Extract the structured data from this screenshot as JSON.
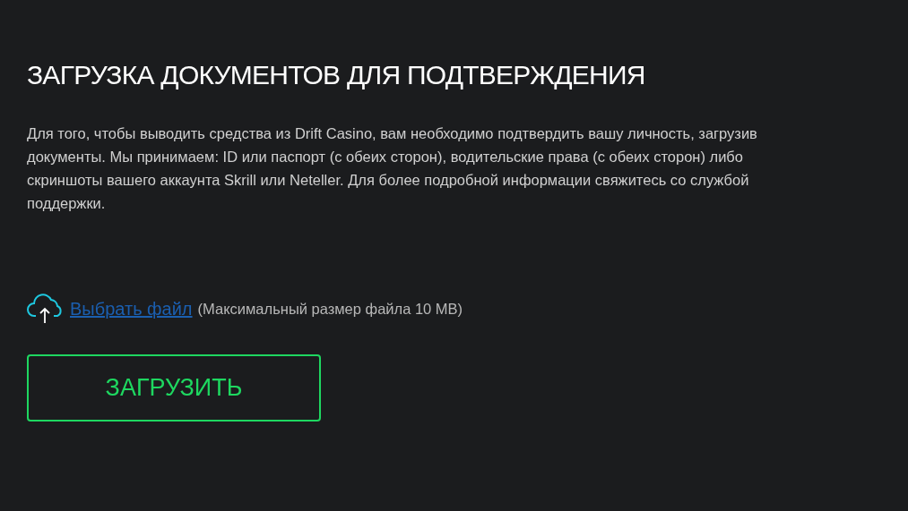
{
  "title": "ЗАГРУЗКА ДОКУМЕНТОВ ДЛЯ ПОДТВЕРЖДЕНИЯ",
  "description": "Для того, чтобы выводить средства из Drift Casino, вам необходимо подтвердить вашу личность, загрузив документы. Мы принимаем: ID или паспорт (с обеих сторон), водительские права (с обеих сторон) либо скриншоты вашего аккаунта Skrill или Neteller. Для более подробной информации свяжитесь со службой поддержки.",
  "file_picker": {
    "link": "Выбрать файл",
    "hint": "(Максимальный размер файла 10 MB)"
  },
  "upload_button": "ЗАГРУЗИТЬ"
}
